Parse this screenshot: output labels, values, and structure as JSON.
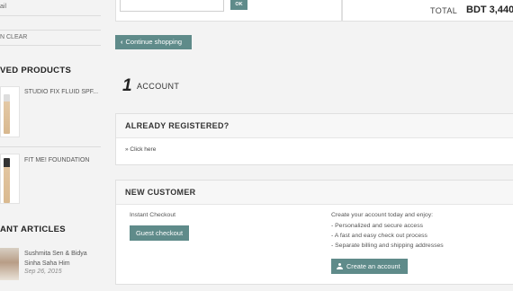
{
  "sidebar": {
    "top_text_1": "ail",
    "top_text_2": "N CLEAR",
    "viewed_heading": "VED PRODUCTS",
    "products": [
      {
        "name": "STUDIO FIX FLUID SPF..."
      },
      {
        "name": "FIT ME! FOUNDATION"
      }
    ],
    "articles_heading": "ANT ARTICLES",
    "article": {
      "title_line1": "Sushmita Sen & Bidya",
      "title_line2": "Sinha Saha Him",
      "date": "Sep 26, 2015"
    }
  },
  "coupon": {
    "ok_label": "OK"
  },
  "totals": {
    "label": "TOTAL",
    "value": "BDT 3,440"
  },
  "continue_label": "Continue shopping",
  "step": {
    "number": "1",
    "label": "ACCOUNT"
  },
  "registered": {
    "heading": "ALREADY REGISTERED?",
    "link": "» Click here"
  },
  "new_customer": {
    "heading": "NEW CUSTOMER",
    "instant_label": "Instant Checkout",
    "guest_button": "Guest checkout",
    "intro": "Create your account today and enjoy:",
    "benefits": [
      "- Personalized and secure access",
      "- A fast and easy check out process",
      "- Separate billing and shipping addresses"
    ],
    "create_button": "Create an account"
  },
  "colors": {
    "accent": "#5f8b8a",
    "background": "#f3f3f3"
  }
}
